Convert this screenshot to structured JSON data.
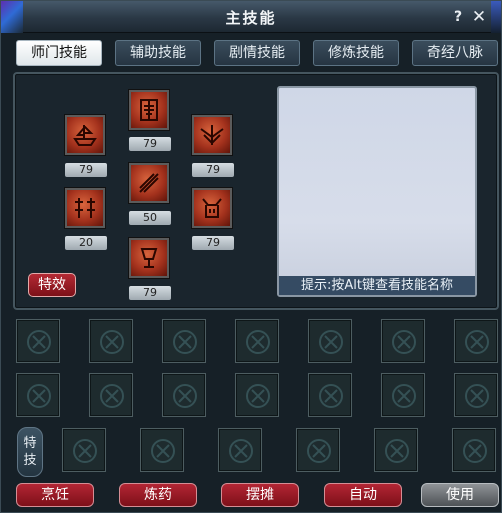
{
  "window": {
    "title": "主技能",
    "help_label": "?",
    "close_label": "✕"
  },
  "tabs": [
    {
      "label": "师门技能",
      "active": true
    },
    {
      "label": "辅助技能",
      "active": false
    },
    {
      "label": "剧情技能",
      "active": false
    },
    {
      "label": "修炼技能",
      "active": false
    },
    {
      "label": "奇经八脉",
      "active": false
    }
  ],
  "skills": [
    {
      "icon": "war-ship-icon",
      "level": "79"
    },
    {
      "icon": "ornate-mask-icon",
      "level": "79"
    },
    {
      "icon": "winged-emblem-icon",
      "level": "79"
    },
    {
      "icon": "twin-pillars-icon",
      "level": "20"
    },
    {
      "icon": "slash-blade-icon",
      "level": "50"
    },
    {
      "icon": "demon-face-icon",
      "level": "79"
    },
    {
      "icon": "chalice-icon",
      "level": "79"
    }
  ],
  "effect_button": "特效",
  "hint": "提示:按Alt键查看技能名称",
  "special_label": "特技",
  "buttons": {
    "cook": "烹饪",
    "potion": "炼药",
    "stall": "摆摊",
    "auto": "自动",
    "use": "使用"
  },
  "colors": {
    "skill_icon": "#b23a22",
    "button_red": "#a31d2a",
    "hint_bar": "#354b63"
  }
}
